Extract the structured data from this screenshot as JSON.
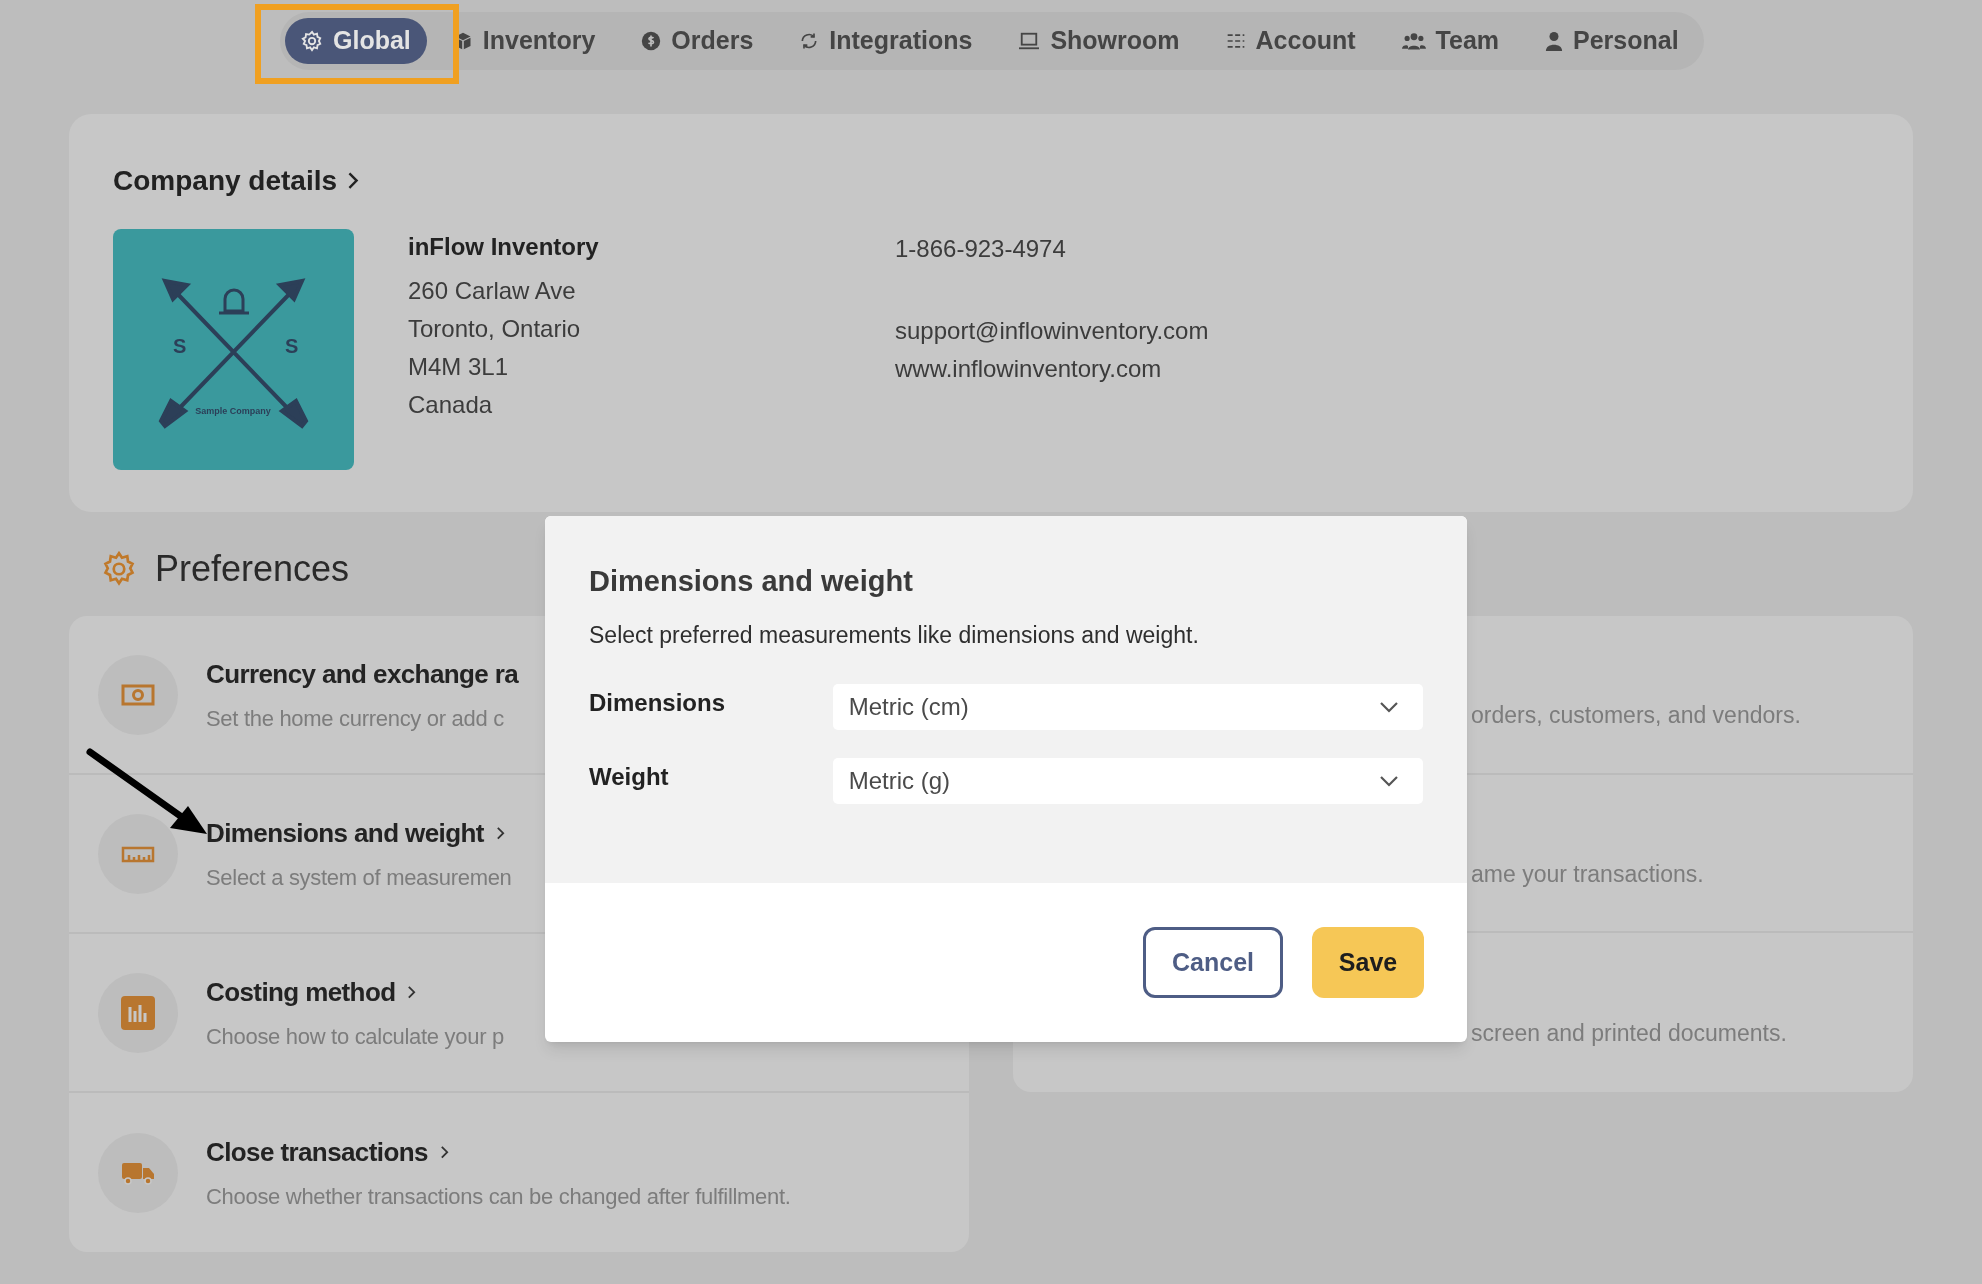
{
  "nav": {
    "tabs": [
      {
        "label": "Global",
        "selected": true
      },
      {
        "label": "Inventory",
        "selected": false
      },
      {
        "label": "Orders",
        "selected": false
      },
      {
        "label": "Integrations",
        "selected": false
      },
      {
        "label": "Showroom",
        "selected": false
      },
      {
        "label": "Account",
        "selected": false
      },
      {
        "label": "Team",
        "selected": false
      },
      {
        "label": "Personal",
        "selected": false
      }
    ]
  },
  "company": {
    "heading": "Company details",
    "logo": {
      "letters": [
        "S",
        "S"
      ],
      "caption": "Sample Company"
    },
    "name": "inFlow Inventory",
    "address": [
      "260 Carlaw Ave",
      "Toronto, Ontario",
      "M4M 3L1",
      "Canada"
    ],
    "phone": "1-866-923-4974",
    "email": "support@inflowinventory.com",
    "website": "www.inflowinventory.com"
  },
  "preferences": {
    "heading": "Preferences",
    "left": [
      {
        "title": "Currency and exchange ra",
        "description": "Set the home currency or add c"
      },
      {
        "title": "Dimensions and weight",
        "description": "Select a system of measuremen"
      },
      {
        "title": "Costing method",
        "description": "Choose how to calculate your p"
      },
      {
        "title": "Close transactions",
        "description": "Choose whether transactions can be changed after fulfillment."
      }
    ],
    "right": [
      {
        "description": "orders, customers, and vendors."
      },
      {
        "description": "ame your transactions."
      },
      {
        "description": "screen and printed documents."
      }
    ]
  },
  "dialog": {
    "title": "Dimensions and weight",
    "subtitle": "Select preferred measurements like dimensions and weight.",
    "fields": [
      {
        "label": "Dimensions",
        "value": "Metric (cm)"
      },
      {
        "label": "Weight",
        "value": "Metric (g)"
      }
    ],
    "buttons": [
      {
        "label": "Cancel",
        "kind": "secondary"
      },
      {
        "label": "Save",
        "kind": "primary"
      }
    ]
  }
}
